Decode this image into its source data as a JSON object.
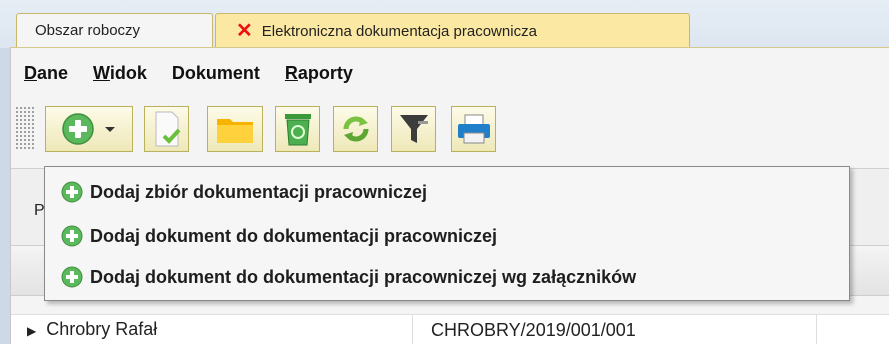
{
  "tabs": [
    {
      "label": "Obszar roboczy",
      "active": false
    },
    {
      "label": "Elektroniczna dokumentacja pracownicza",
      "active": true,
      "close_icon": "close-icon"
    }
  ],
  "menu": {
    "dane_prefix": "D",
    "dane_rest": "ane",
    "widok_prefix": "W",
    "widok_rest": "idok",
    "dokument": "Dokument",
    "raporty_prefix": "R",
    "raporty_rest": "aporty"
  },
  "toolbar": {
    "buttons": [
      "add-icon",
      "document-approve-icon",
      "folder-icon",
      "recycle-bin-icon",
      "refresh-icon",
      "filter-icon",
      "print-icon"
    ]
  },
  "dropdown": {
    "items": [
      "Dodaj zbiór dokumentacji pracowniczej",
      "Dodaj dokument do dokumentacji pracowniczej",
      "Dodaj dokument do dokumentacji pracowniczej wg załączników"
    ]
  },
  "filter": {
    "label_partial": "P"
  },
  "grid": {
    "rows": [
      {
        "name": "Chrobry Rafał",
        "number": "CHROBRY/2019/001/001"
      }
    ]
  },
  "colors": {
    "active_tab": "#fbe9a3",
    "accent_green": "#5cb85c",
    "close_red": "#e11111"
  }
}
